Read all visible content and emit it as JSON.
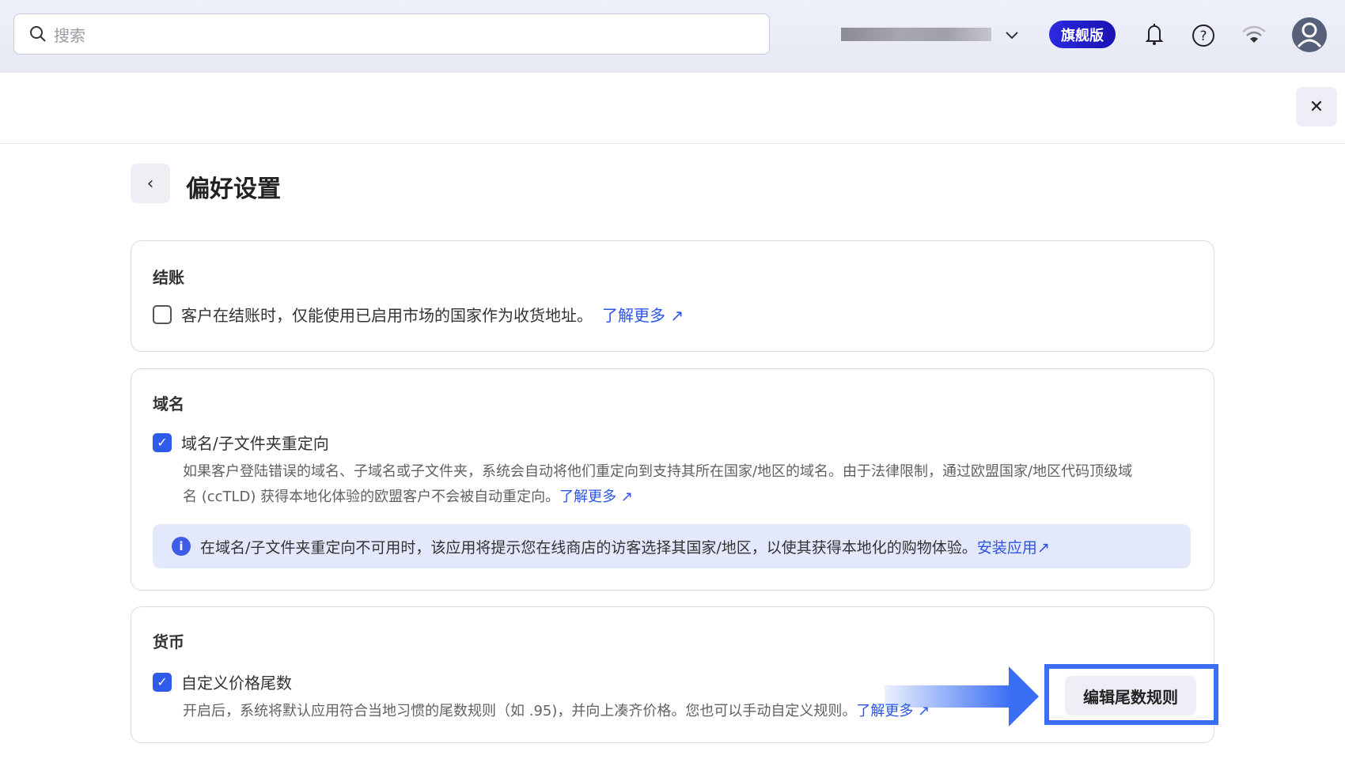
{
  "topbar": {
    "search_placeholder": "搜索",
    "plan_badge": "旗舰版",
    "icons": [
      "search-icon",
      "chevron-down-icon",
      "bell-icon",
      "help-icon",
      "wifi-icon",
      "avatar-icon"
    ]
  },
  "page": {
    "title": "偏好设置",
    "close": "✕",
    "back": "‹"
  },
  "checkout": {
    "heading": "结账",
    "option": "客户在结账时，仅能使用已启用市场的国家作为收货地址。",
    "link": "了解更多",
    "checked": false
  },
  "domain": {
    "heading": "域名",
    "option": "域名/子文件夹重定向",
    "checked": true,
    "desc1": "如果客户登陆错误的域名、子域名或子文件夹，系统会自动将他们重定向到支持其所在国家/地区的域名。由于法律限制，通过欧盟国家/地区代码顶级域",
    "desc2": "名 (ccTLD) 获得本地化体验的欧盟客户不会被自动重定向。",
    "link": "了解更多",
    "info": "在域名/子文件夹重定向不可用时，该应用将提示您在线商店的访客选择其国家/地区，以使其获得本地化的购物体验。",
    "info_link": "安装应用"
  },
  "currency": {
    "heading": "货币",
    "option": "自定义价格尾数",
    "checked": true,
    "desc": "开启后，系统将默认应用符合当地习惯的尾数规则（如 .95)，并向上凑齐价格。您也可以手动自定义规则。",
    "link": "了解更多",
    "button": "编辑尾数规则"
  }
}
